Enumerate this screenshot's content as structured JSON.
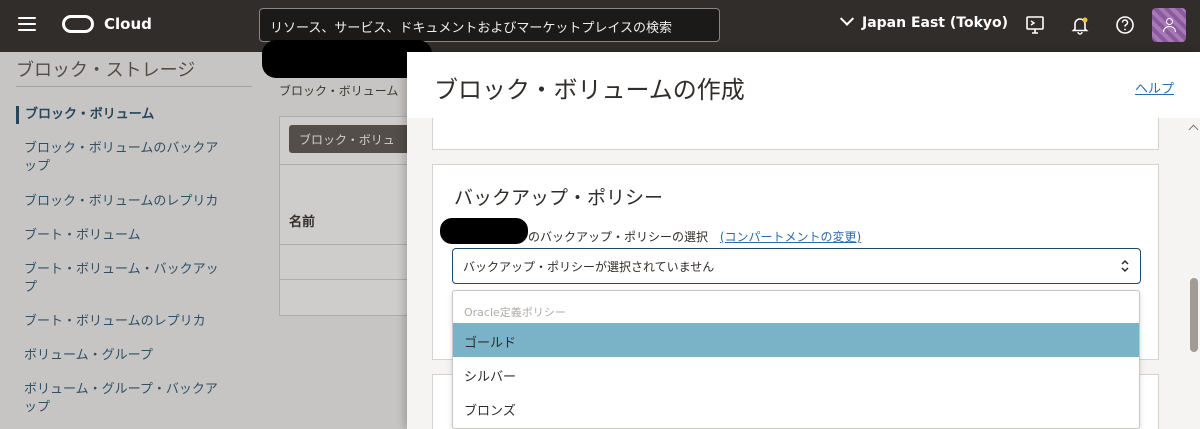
{
  "topbar": {
    "brand": "Cloud",
    "search_placeholder": "リソース、サービス、ドキュメントおよびマーケットプレイスの検索",
    "region": "Japan East (Tokyo)"
  },
  "background_page": {
    "sidebar_title": "ブロック・ストレージ",
    "nav_items": [
      "ブロック・ボリューム",
      "ブロック・ボリュームのバックアップ",
      "ブロック・ボリュームのレプリカ",
      "ブート・ボリューム",
      "ブート・ボリューム・バックアップ",
      "ブート・ボリュームのレプリカ",
      "ボリューム・グループ",
      "ボリューム・グループ・バックアップ"
    ],
    "breadcrumb": "ブロック・ボリューム",
    "create_button": "ブロック・ボリュ",
    "column_header": "名前"
  },
  "panel": {
    "title": "ブロック・ボリュームの作成",
    "help": "ヘルプ",
    "section_title": "バックアップ・ポリシー",
    "field_label": "のバックアップ・ポリシーの選択",
    "change_compartment": "(コンパートメントの変更)",
    "select_value": "バックアップ・ポリシーが選択されていません",
    "dropdown": {
      "group_label": "Oracle定義ポリシー",
      "options": [
        "ゴールド",
        "シルバー",
        "ブロンズ"
      ],
      "highlighted": "ゴールド"
    }
  },
  "colors": {
    "topbar": "#312d2a",
    "link": "#2b6cb0",
    "highlight": "#7ab2c8"
  }
}
